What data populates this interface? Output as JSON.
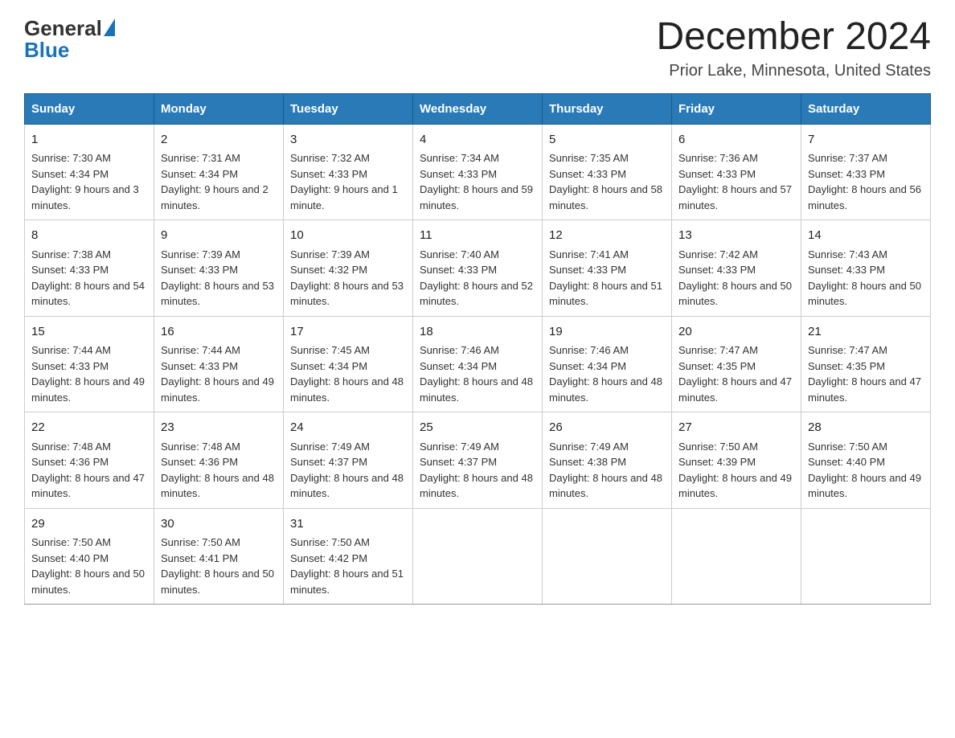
{
  "header": {
    "logo_general": "General",
    "logo_blue": "Blue",
    "title": "December 2024",
    "subtitle": "Prior Lake, Minnesota, United States"
  },
  "days_of_week": [
    "Sunday",
    "Monday",
    "Tuesday",
    "Wednesday",
    "Thursday",
    "Friday",
    "Saturday"
  ],
  "weeks": [
    [
      {
        "day": "1",
        "sunrise": "7:30 AM",
        "sunset": "4:34 PM",
        "daylight": "9 hours and 3 minutes."
      },
      {
        "day": "2",
        "sunrise": "7:31 AM",
        "sunset": "4:34 PM",
        "daylight": "9 hours and 2 minutes."
      },
      {
        "day": "3",
        "sunrise": "7:32 AM",
        "sunset": "4:33 PM",
        "daylight": "9 hours and 1 minute."
      },
      {
        "day": "4",
        "sunrise": "7:34 AM",
        "sunset": "4:33 PM",
        "daylight": "8 hours and 59 minutes."
      },
      {
        "day": "5",
        "sunrise": "7:35 AM",
        "sunset": "4:33 PM",
        "daylight": "8 hours and 58 minutes."
      },
      {
        "day": "6",
        "sunrise": "7:36 AM",
        "sunset": "4:33 PM",
        "daylight": "8 hours and 57 minutes."
      },
      {
        "day": "7",
        "sunrise": "7:37 AM",
        "sunset": "4:33 PM",
        "daylight": "8 hours and 56 minutes."
      }
    ],
    [
      {
        "day": "8",
        "sunrise": "7:38 AM",
        "sunset": "4:33 PM",
        "daylight": "8 hours and 54 minutes."
      },
      {
        "day": "9",
        "sunrise": "7:39 AM",
        "sunset": "4:33 PM",
        "daylight": "8 hours and 53 minutes."
      },
      {
        "day": "10",
        "sunrise": "7:39 AM",
        "sunset": "4:32 PM",
        "daylight": "8 hours and 53 minutes."
      },
      {
        "day": "11",
        "sunrise": "7:40 AM",
        "sunset": "4:33 PM",
        "daylight": "8 hours and 52 minutes."
      },
      {
        "day": "12",
        "sunrise": "7:41 AM",
        "sunset": "4:33 PM",
        "daylight": "8 hours and 51 minutes."
      },
      {
        "day": "13",
        "sunrise": "7:42 AM",
        "sunset": "4:33 PM",
        "daylight": "8 hours and 50 minutes."
      },
      {
        "day": "14",
        "sunrise": "7:43 AM",
        "sunset": "4:33 PM",
        "daylight": "8 hours and 50 minutes."
      }
    ],
    [
      {
        "day": "15",
        "sunrise": "7:44 AM",
        "sunset": "4:33 PM",
        "daylight": "8 hours and 49 minutes."
      },
      {
        "day": "16",
        "sunrise": "7:44 AM",
        "sunset": "4:33 PM",
        "daylight": "8 hours and 49 minutes."
      },
      {
        "day": "17",
        "sunrise": "7:45 AM",
        "sunset": "4:34 PM",
        "daylight": "8 hours and 48 minutes."
      },
      {
        "day": "18",
        "sunrise": "7:46 AM",
        "sunset": "4:34 PM",
        "daylight": "8 hours and 48 minutes."
      },
      {
        "day": "19",
        "sunrise": "7:46 AM",
        "sunset": "4:34 PM",
        "daylight": "8 hours and 48 minutes."
      },
      {
        "day": "20",
        "sunrise": "7:47 AM",
        "sunset": "4:35 PM",
        "daylight": "8 hours and 47 minutes."
      },
      {
        "day": "21",
        "sunrise": "7:47 AM",
        "sunset": "4:35 PM",
        "daylight": "8 hours and 47 minutes."
      }
    ],
    [
      {
        "day": "22",
        "sunrise": "7:48 AM",
        "sunset": "4:36 PM",
        "daylight": "8 hours and 47 minutes."
      },
      {
        "day": "23",
        "sunrise": "7:48 AM",
        "sunset": "4:36 PM",
        "daylight": "8 hours and 48 minutes."
      },
      {
        "day": "24",
        "sunrise": "7:49 AM",
        "sunset": "4:37 PM",
        "daylight": "8 hours and 48 minutes."
      },
      {
        "day": "25",
        "sunrise": "7:49 AM",
        "sunset": "4:37 PM",
        "daylight": "8 hours and 48 minutes."
      },
      {
        "day": "26",
        "sunrise": "7:49 AM",
        "sunset": "4:38 PM",
        "daylight": "8 hours and 48 minutes."
      },
      {
        "day": "27",
        "sunrise": "7:50 AM",
        "sunset": "4:39 PM",
        "daylight": "8 hours and 49 minutes."
      },
      {
        "day": "28",
        "sunrise": "7:50 AM",
        "sunset": "4:40 PM",
        "daylight": "8 hours and 49 minutes."
      }
    ],
    [
      {
        "day": "29",
        "sunrise": "7:50 AM",
        "sunset": "4:40 PM",
        "daylight": "8 hours and 50 minutes."
      },
      {
        "day": "30",
        "sunrise": "7:50 AM",
        "sunset": "4:41 PM",
        "daylight": "8 hours and 50 minutes."
      },
      {
        "day": "31",
        "sunrise": "7:50 AM",
        "sunset": "4:42 PM",
        "daylight": "8 hours and 51 minutes."
      },
      null,
      null,
      null,
      null
    ]
  ],
  "labels": {
    "sunrise_prefix": "Sunrise: ",
    "sunset_prefix": "Sunset: ",
    "daylight_prefix": "Daylight: "
  }
}
